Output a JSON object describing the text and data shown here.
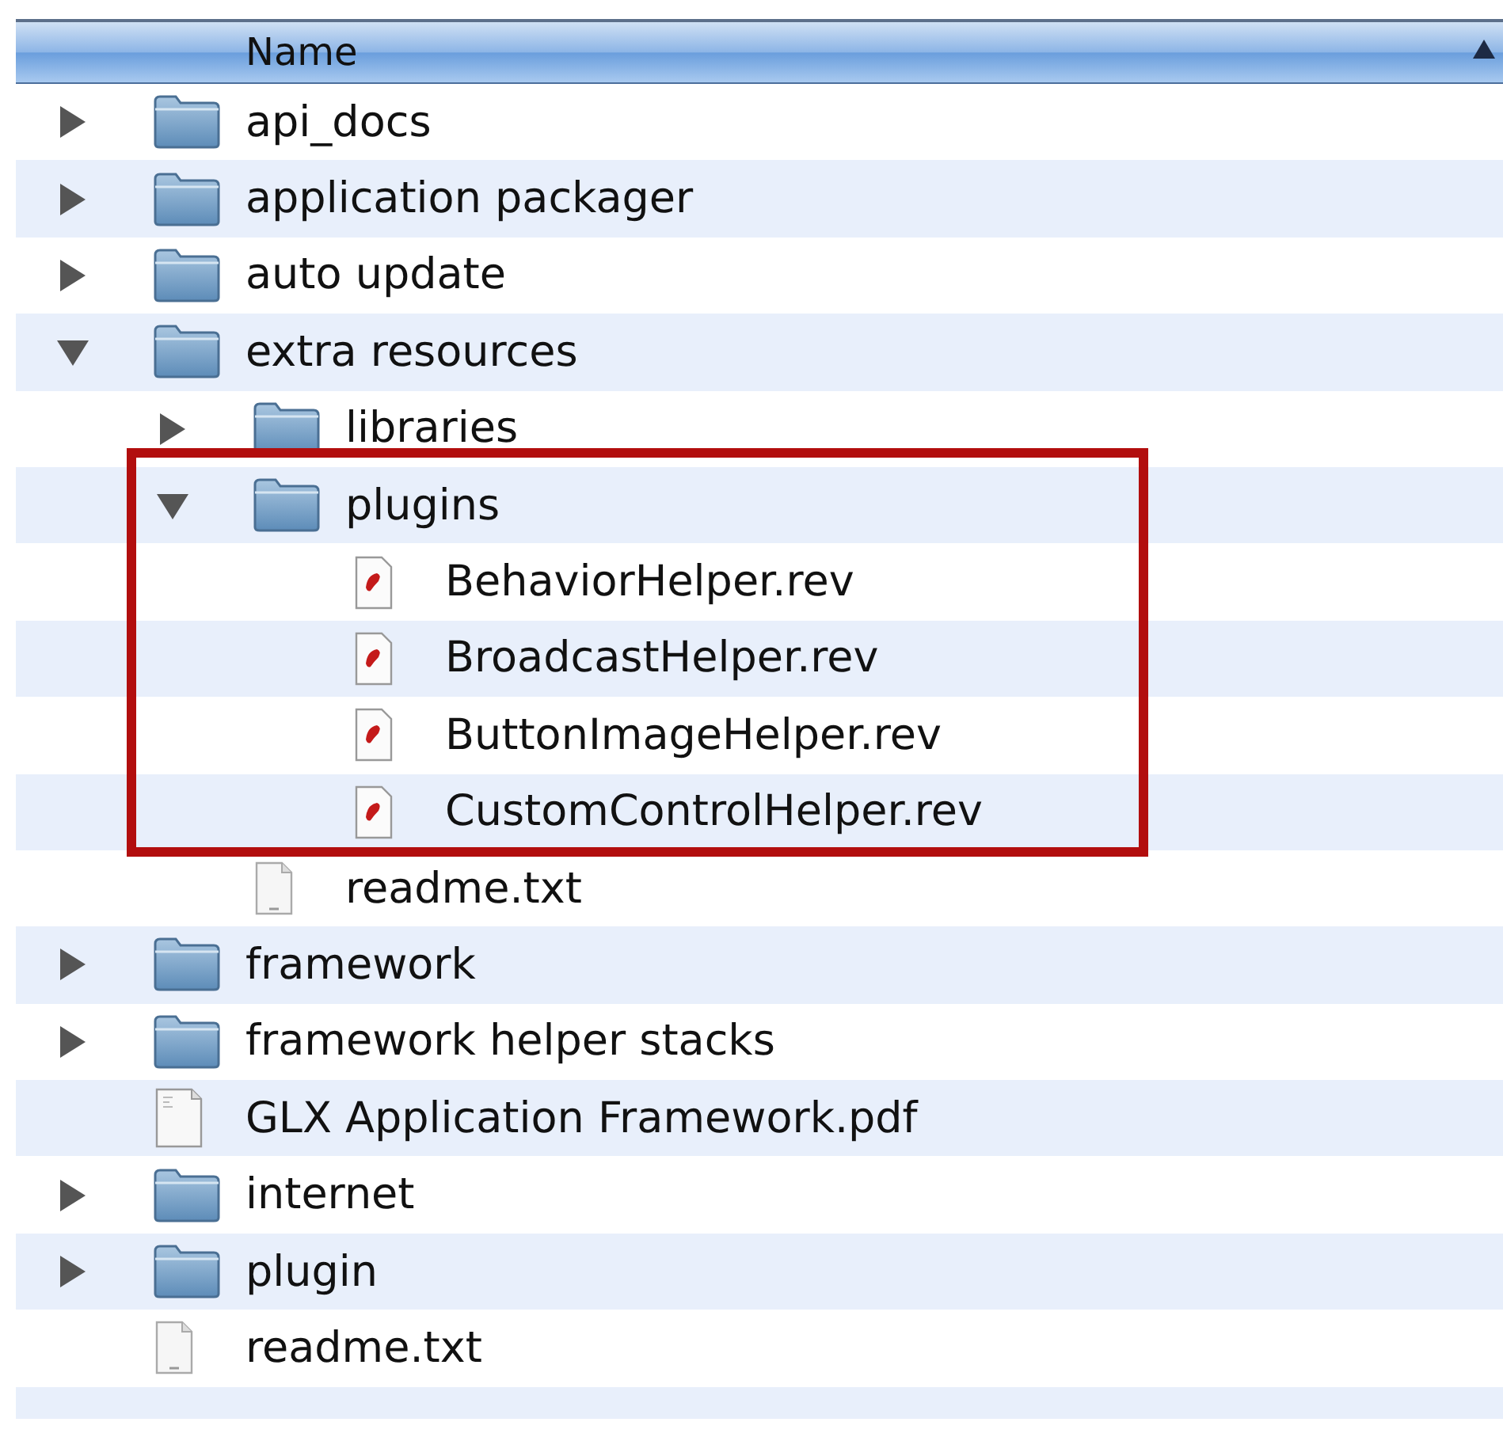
{
  "header": {
    "column": "Name",
    "sort_ascending": true
  },
  "items": [
    {
      "name": "api_docs",
      "kind": "folder",
      "expanded": false
    },
    {
      "name": "application packager",
      "kind": "folder",
      "expanded": false
    },
    {
      "name": "auto update",
      "kind": "folder",
      "expanded": false
    },
    {
      "name": "extra resources",
      "kind": "folder",
      "expanded": true,
      "children": [
        {
          "name": "libraries",
          "kind": "folder",
          "expanded": false
        },
        {
          "name": "plugins",
          "kind": "folder",
          "expanded": true,
          "highlighted": true,
          "children": [
            {
              "name": "BehaviorHelper.rev",
              "kind": "rev"
            },
            {
              "name": "BroadcastHelper.rev",
              "kind": "rev"
            },
            {
              "name": "ButtonImageHelper.rev",
              "kind": "rev"
            },
            {
              "name": "CustomControlHelper.rev",
              "kind": "rev"
            }
          ]
        },
        {
          "name": "readme.txt",
          "kind": "text"
        }
      ]
    },
    {
      "name": "framework",
      "kind": "folder",
      "expanded": false
    },
    {
      "name": "framework helper stacks",
      "kind": "folder",
      "expanded": false
    },
    {
      "name": "GLX Application Framework.pdf",
      "kind": "pdf"
    },
    {
      "name": "internet",
      "kind": "folder",
      "expanded": false
    },
    {
      "name": "plugin",
      "kind": "folder",
      "expanded": false
    },
    {
      "name": "readme.txt",
      "kind": "text"
    }
  ]
}
